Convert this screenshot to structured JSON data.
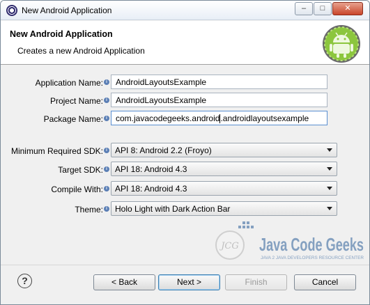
{
  "window": {
    "title": "New Android Application",
    "controls": {
      "minimize": "–",
      "maximize": "□",
      "close": "✕"
    }
  },
  "header": {
    "title": "New Android Application",
    "subtitle": "Creates a new Android Application"
  },
  "form": {
    "application_name": {
      "label": "Application Name:",
      "value": "AndroidLayoutsExample"
    },
    "project_name": {
      "label": "Project Name:",
      "value": "AndroidLayoutsExample"
    },
    "package_name": {
      "label": "Package Name:",
      "value_before_caret": "com.javacodegeeks.android",
      "value_after_caret": ".androidlayoutsexample"
    },
    "min_sdk": {
      "label": "Minimum Required SDK:",
      "value": "API 8: Android 2.2 (Froyo)"
    },
    "target_sdk": {
      "label": "Target SDK:",
      "value": "API 18: Android 4.3"
    },
    "compile_with": {
      "label": "Compile With:",
      "value": "API 18: Android 4.3"
    },
    "theme": {
      "label": "Theme:",
      "value": "Holo Light with Dark Action Bar"
    }
  },
  "info_glyph": "i",
  "watermark": {
    "badge": "JCG",
    "name": "Java Code Geeks",
    "tagline": "JAVA 2 JAVA DEVELOPERS RESOURCE CENTER"
  },
  "buttons": {
    "help": "?",
    "back": "< Back",
    "next": "Next >",
    "finish": "Finish",
    "cancel": "Cancel"
  },
  "colors": {
    "android_green": "#8cc63e",
    "watermark_blue": "#2d5f9a",
    "watermark_gold": "#d9a21b"
  }
}
